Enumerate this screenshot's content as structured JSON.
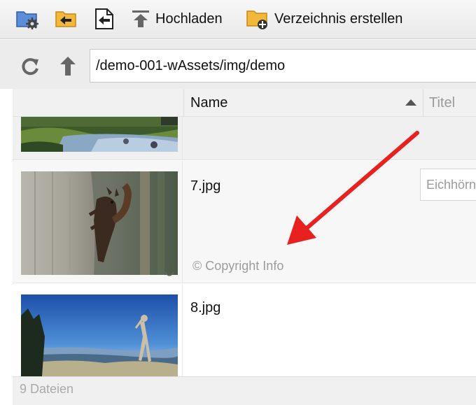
{
  "toolbar": {
    "settings_icon": "folder-gear-icon",
    "back_icon": "folder-back-icon",
    "import_icon": "document-import-icon",
    "upload_label": "Hochladen",
    "upload_icon": "upload-icon",
    "create_dir_label": "Verzeichnis erstellen",
    "create_dir_icon": "folder-add-icon"
  },
  "pathbar": {
    "refresh_icon": "refresh-icon",
    "up_icon": "arrow-up-icon",
    "path": "/demo-001-wAssets/img/demo"
  },
  "columns": {
    "name": "Name",
    "title": "Titel",
    "sort": "ascending"
  },
  "files": [
    {
      "name": "",
      "thumbnail": "river-landscape"
    },
    {
      "name": "7.jpg",
      "thumbnail": "squirrel-on-tree",
      "copyright": "© Copyright Info",
      "title_value": "Eichhörnchen"
    },
    {
      "name": "8.jpg",
      "thumbnail": "mountain-view-statue"
    }
  ],
  "footer": {
    "count_text": "9 Dateien"
  },
  "colors": {
    "annotation_arrow": "#e8201e",
    "folder": "#f3b73a"
  }
}
